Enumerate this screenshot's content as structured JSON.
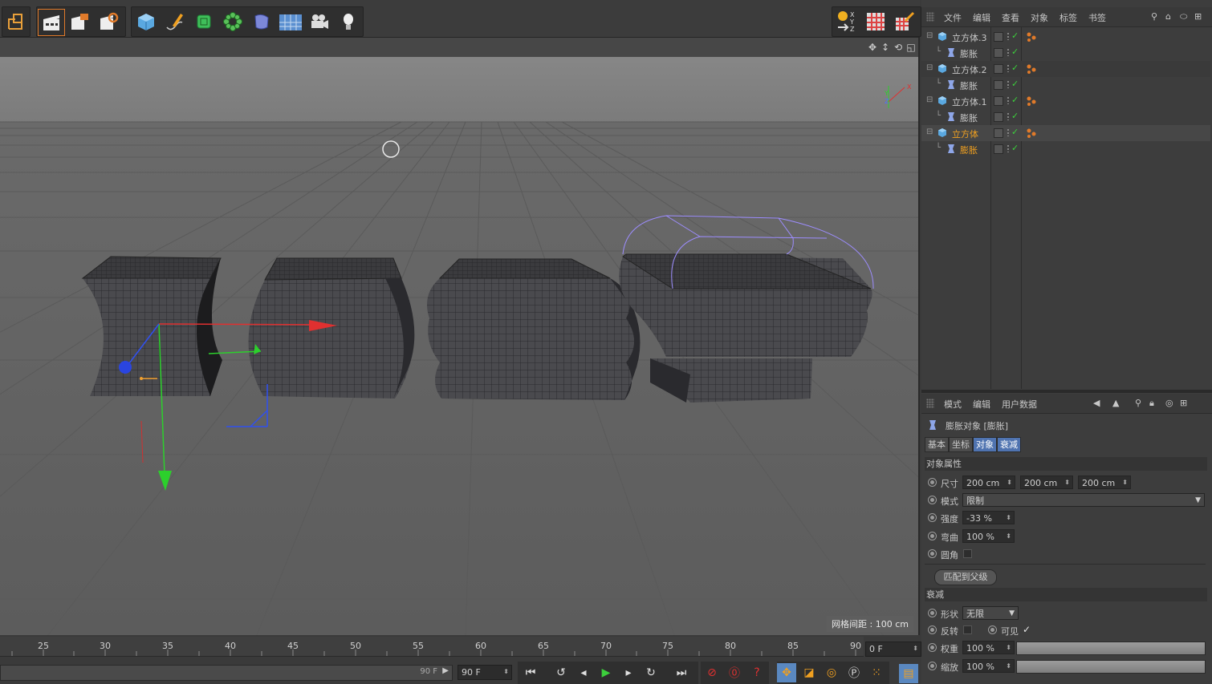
{
  "toolbar": {
    "icons": [
      "undo-cube-icon",
      "render-view-icon",
      "render-picture-viewer-icon",
      "render-settings-icon",
      "cube-primitive-icon",
      "pen-spline-icon",
      "subdivision-surface-icon",
      "cloner-icon",
      "deformer-icon",
      "floor-environment-icon",
      "camera-icon",
      "light-icon",
      "coordinate-system-icon",
      "texture-icon",
      "paint-icon"
    ],
    "xyz_label": [
      "X",
      "Y",
      "Z"
    ]
  },
  "viewport": {
    "grid_spacing": "网格间距 : 100 cm",
    "axis_labels": {
      "y": "Y",
      "z": "Z",
      "x": "X"
    }
  },
  "timeline": {
    "ticks": [
      "25",
      "30",
      "35",
      "40",
      "45",
      "50",
      "55",
      "60",
      "65",
      "70",
      "75",
      "80",
      "85",
      "90"
    ],
    "current_frame": "0 F",
    "end_frame_small": "90 F",
    "end_frame": "90 F"
  },
  "object_manager": {
    "menu": [
      "文件",
      "编辑",
      "查看",
      "对象",
      "标签",
      "书签"
    ],
    "rows": [
      {
        "name": "立方体.3",
        "type": "cube",
        "selected": false,
        "indent": 0
      },
      {
        "name": "膨胀",
        "type": "deformer",
        "selected": false,
        "indent": 1
      },
      {
        "name": "立方体.2",
        "type": "cube",
        "selected": false,
        "indent": 0
      },
      {
        "name": "膨胀",
        "type": "deformer",
        "selected": false,
        "indent": 1
      },
      {
        "name": "立方体.1",
        "type": "cube",
        "selected": false,
        "indent": 0
      },
      {
        "name": "膨胀",
        "type": "deformer",
        "selected": false,
        "indent": 1
      },
      {
        "name": "立方体",
        "type": "cube",
        "selected": true,
        "indent": 0
      },
      {
        "name": "膨胀",
        "type": "deformer",
        "selected": true,
        "indent": 1
      }
    ],
    "selected_color": "#f0a020"
  },
  "attributes": {
    "menu": [
      "模式",
      "编辑",
      "用户数据"
    ],
    "title": "膨胀对象 [膨胀]",
    "tabs": [
      "基本",
      "坐标",
      "对象",
      "衰减"
    ],
    "active_tab": "对象",
    "section_object": "对象属性",
    "size_label": "尺寸",
    "size_values": [
      "200 cm",
      "200 cm",
      "200 cm"
    ],
    "mode_label": "模式",
    "mode_value": "限制",
    "strength_label": "强度",
    "strength_value": "-33 %",
    "curvature_label": "弯曲",
    "curvature_value": "100 %",
    "round_label": "圆角",
    "fit_button": "匹配到父级",
    "section_falloff": "衰减",
    "shape_label": "形状",
    "shape_value": "无限",
    "invert_label": "反转",
    "visible_label": "可见",
    "visible_check": "✓",
    "weight_label": "权重",
    "weight_value": "100 %",
    "scale_label": "缩放",
    "scale_value": "100 %"
  }
}
